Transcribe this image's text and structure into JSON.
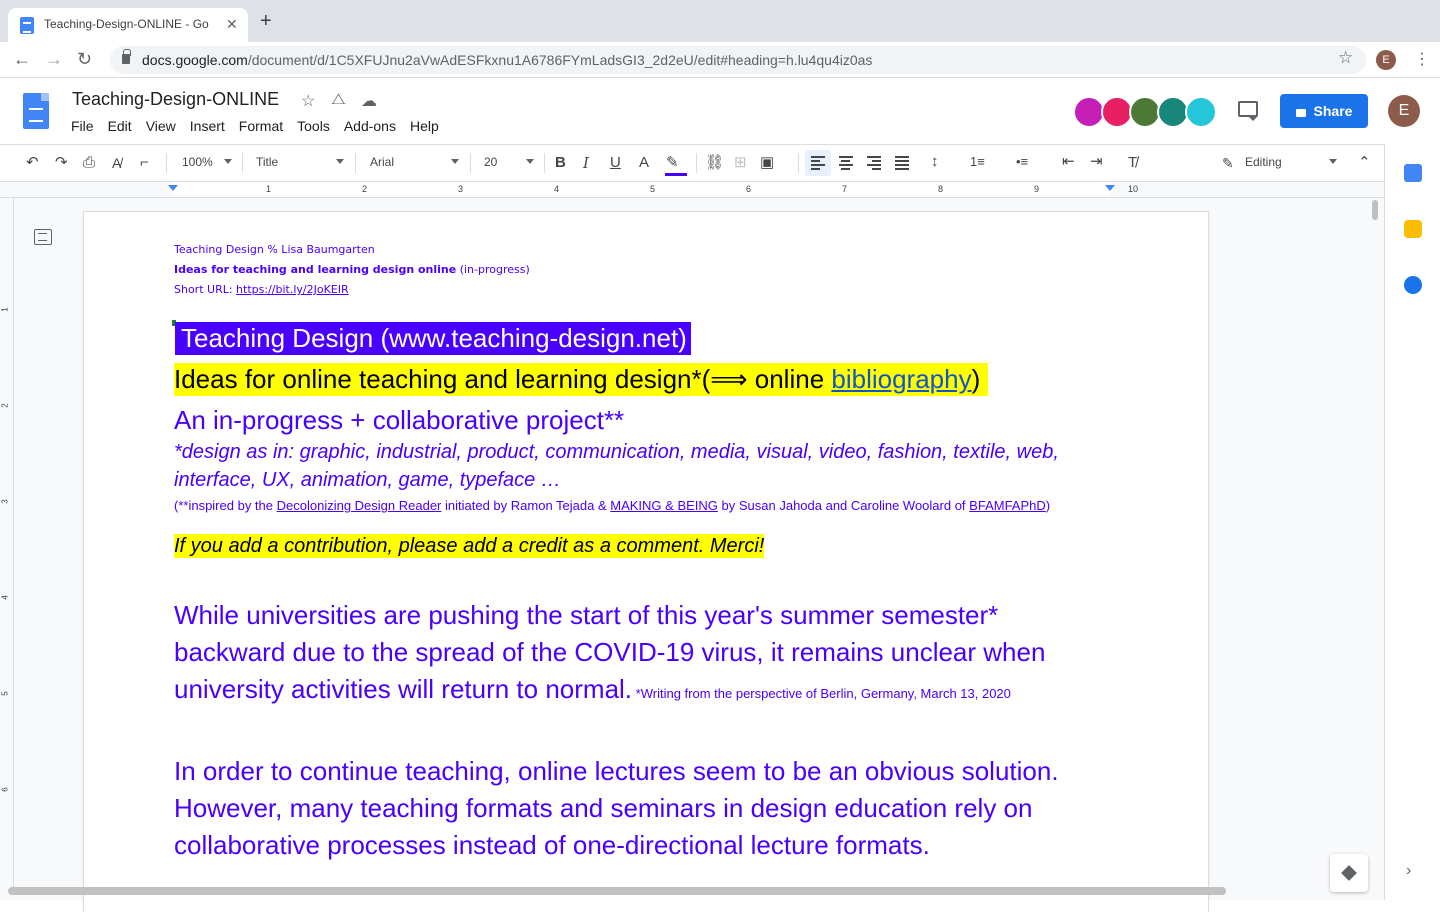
{
  "browser": {
    "tab_title": "Teaching-Design-ONLINE - Go",
    "tab_close": "✕",
    "new_tab": "+",
    "url_host": "docs.google.com",
    "url_path": "/document/d/1C5XFUJnu2aVwAdESFkxnu1A6786FYmLadsGI3_2d2eU/edit#heading=h.lu4qu4iz0as",
    "profile_initial": "E"
  },
  "docs": {
    "title": "Teaching-Design-ONLINE",
    "menu": [
      "File",
      "Edit",
      "View",
      "Insert",
      "Format",
      "Tools",
      "Add-ons",
      "Help"
    ],
    "share_label": "Share",
    "profile_initial": "E",
    "collaborator_colors": [
      "#c51fb8",
      "#e91e63",
      "#4c7a35",
      "#16877a",
      "#26c6da"
    ]
  },
  "toolbar": {
    "zoom": "100%",
    "style": "Title",
    "font": "Arial",
    "font_size": "20",
    "mode": "Editing"
  },
  "ruler": {
    "numbers": [
      "1",
      "2",
      "3",
      "4",
      "5",
      "6",
      "7",
      "8",
      "9",
      "10"
    ],
    "vertical_numbers": [
      "1",
      "2",
      "3",
      "4",
      "5",
      "6"
    ]
  },
  "document": {
    "header_line1": "Teaching Design  % Lisa Baumgarten",
    "header_line2_bold": "Ideas for teaching and learning design online",
    "header_line2_rest": " (in-progress)",
    "header_line3_label": "Short URL: ",
    "header_line3_link": "https://bit.ly/2JoKEIR",
    "title": "Teaching Design (www.teaching-design.net)",
    "ideas_text": "Ideas for online teaching and learning design*(⟹ online ",
    "ideas_link": "bibliography",
    "ideas_close": ")",
    "inprogress": "An in-progress + collaborative project**",
    "design_line1": "*design as in: graphic, industrial, product, communication, media, visual, video, fashion, textile, web,",
    "design_line2": "interface, UX, animation, game, typeface …",
    "inspired_prefix": "(**inspired by the ",
    "inspired_link1": "Decolonizing Design Reader",
    "inspired_mid1": " initiated by Ramon Tejada &  ",
    "inspired_link2": "MAKING & BEING",
    "inspired_mid2": " by Susan Jahoda and Caroline Woolard of ",
    "inspired_link3": "BFAMFAPhD",
    "inspired_suffix": ")",
    "contribution": "If you add a contribution, please add a credit as a comment. Merci!",
    "while_line1": "While universities are pushing the start of this year's summer semester*",
    "while_line2": "backward due to the spread of the COVID-19 virus, it remains unclear when",
    "while_line3": "university activities will return to normal.",
    "while_note": " *Writing from the perspective of Berlin, Germany, March 13, 2020",
    "order_line1": "In order to continue teaching, online lectures seem to be an obvious solution.",
    "order_line2": "However, many teaching formats and seminars in design education rely on",
    "order_line3": "collaborative processes instead of one-directional lecture formats."
  },
  "colors": {
    "text_purple": "#4a00ff",
    "highlight_yellow": "#ffff00",
    "link_blue": "#1155cc",
    "share_blue": "#1a73e8"
  }
}
